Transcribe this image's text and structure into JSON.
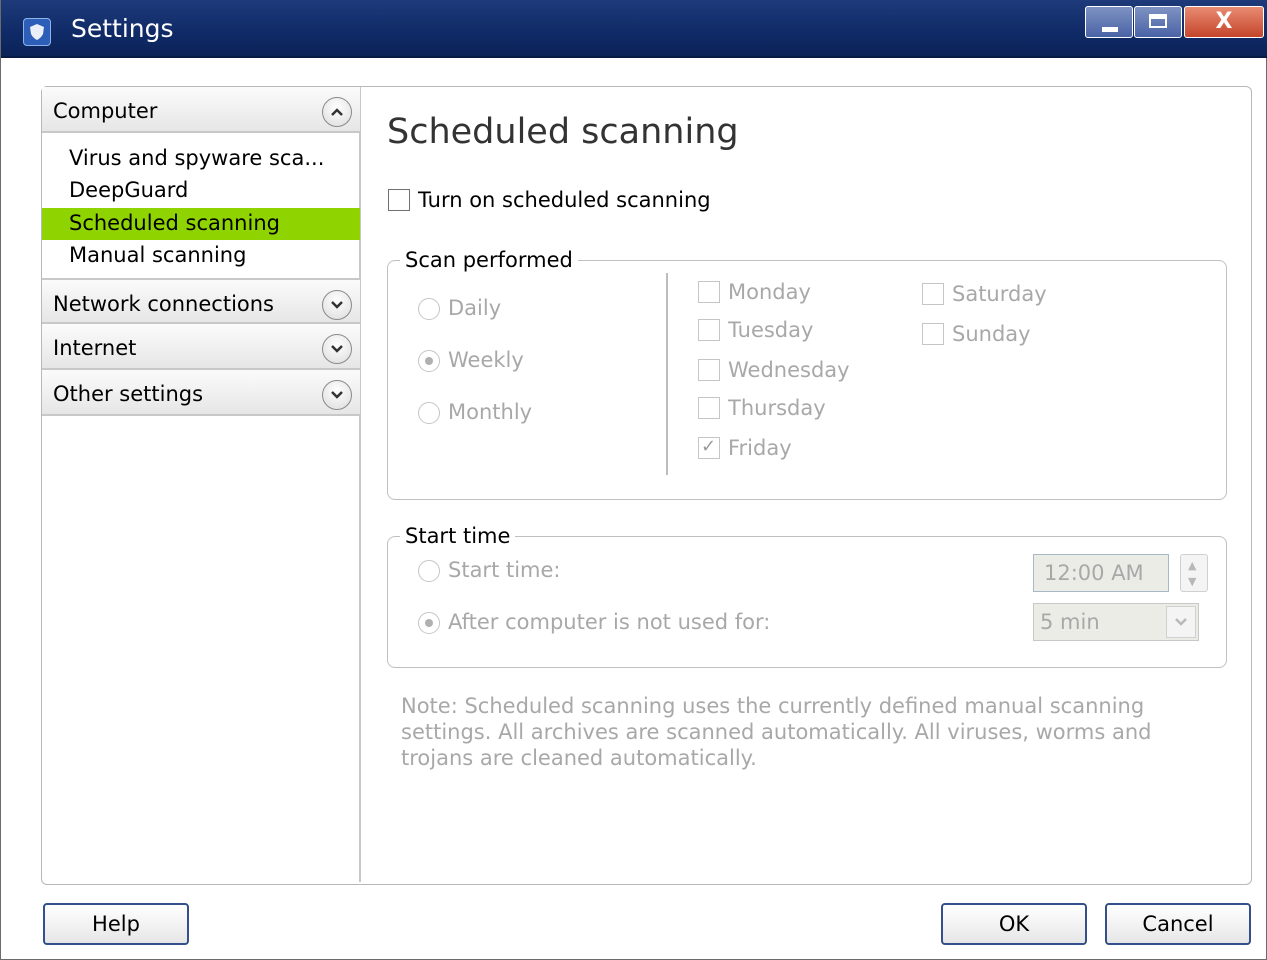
{
  "window": {
    "title": "Settings",
    "close_glyph": "X"
  },
  "sidebar": {
    "sections": [
      {
        "label": "Computer",
        "expanded": true,
        "items": [
          {
            "label": "Virus and spyware sca..."
          },
          {
            "label": "DeepGuard"
          },
          {
            "label": "Scheduled scanning",
            "selected": true
          },
          {
            "label": "Manual scanning"
          }
        ]
      },
      {
        "label": "Network connections",
        "expanded": false
      },
      {
        "label": "Internet",
        "expanded": false
      },
      {
        "label": "Other settings",
        "expanded": false
      }
    ],
    "selected_color": "#8fd400"
  },
  "main": {
    "title": "Scheduled scanning",
    "enable_checkbox": {
      "label": "Turn on scheduled scanning",
      "checked": false
    },
    "scan_performed": {
      "legend": "Scan performed",
      "frequency": [
        {
          "label": "Daily",
          "selected": false
        },
        {
          "label": "Weekly",
          "selected": true
        },
        {
          "label": "Monthly",
          "selected": false
        }
      ],
      "days": [
        {
          "label": "Monday",
          "checked": false
        },
        {
          "label": "Tuesday",
          "checked": false
        },
        {
          "label": "Wednesday",
          "checked": false
        },
        {
          "label": "Thursday",
          "checked": false
        },
        {
          "label": "Friday",
          "checked": true
        },
        {
          "label": "Saturday",
          "checked": false
        },
        {
          "label": "Sunday",
          "checked": false
        }
      ]
    },
    "start_time": {
      "legend": "Start time",
      "option_time_label": "Start time:",
      "option_time_selected": false,
      "time_value": "12:00 AM",
      "option_idle_label": "After computer is not used for:",
      "option_idle_selected": true,
      "idle_value": "5 min"
    },
    "note": "Note: Scheduled scanning uses the currently defined manual scanning settings. All archives are scanned automatically. All viruses, worms and trojans are cleaned automatically."
  },
  "buttons": {
    "help": "Help",
    "ok": "OK",
    "cancel": "Cancel"
  },
  "colors": {
    "titlebar": "#0f2a66",
    "disabled_text": "#a8a8a8"
  }
}
